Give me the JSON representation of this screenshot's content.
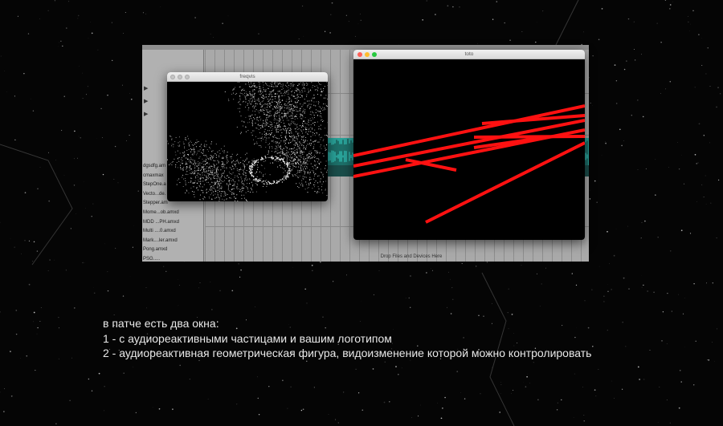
{
  "daw": {
    "files": [
      "dgsdfg.am",
      "cmaxmax",
      "StepOne.a",
      "Vecto...de.",
      "Stepper.am",
      "Mome...ob.amxd",
      "MDD ...PH.amxd",
      "Multi ....0.amxd",
      "Mark....ler.amxd",
      "Pong.amxd",
      "PSG....."
    ],
    "drop_label": "Drop Files and Devices Here"
  },
  "windows": {
    "particles": {
      "title": "freqvis"
    },
    "geometry": {
      "title": "toto"
    }
  },
  "caption": {
    "line1": "в патче есть два окна:",
    "line2": "1 - с аудиореактивными частицами и вашим логотипом",
    "line3": "2 - аудиореактивная геометрическая фигура, видоизменение которой можно контролировать"
  },
  "colors": {
    "background": "#050505",
    "line_red": "#ff1111",
    "track_teal": "#2aa39a"
  }
}
